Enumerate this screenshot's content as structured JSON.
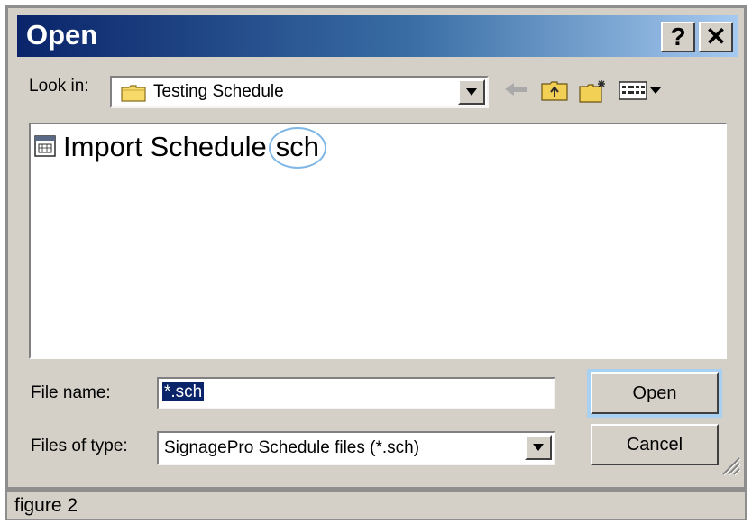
{
  "window": {
    "title": "Open",
    "help_label": "?",
    "close_label": "✕"
  },
  "lookin": {
    "label": "Look in:",
    "value": "Testing Schedule",
    "icons": [
      "folder-icon",
      "back-arrow-icon",
      "up-folder-icon",
      "new-folder-icon",
      "view-menu-icon"
    ]
  },
  "files": [
    {
      "name": "Import Schedule",
      "ext": "sch",
      "icon": "schedule-file-icon"
    }
  ],
  "filename": {
    "label": "File name:",
    "value": "*.sch"
  },
  "filetype": {
    "label": "Files of type:",
    "value": "SignagePro Schedule files (*.sch)"
  },
  "buttons": {
    "open": "Open",
    "cancel": "Cancel"
  },
  "caption": "figure 2",
  "colors": {
    "title_start": "#0a246a",
    "title_end": "#a6caf0",
    "dialog_bg": "#d4d0c8",
    "highlight_ring": "#7fb7e6"
  }
}
